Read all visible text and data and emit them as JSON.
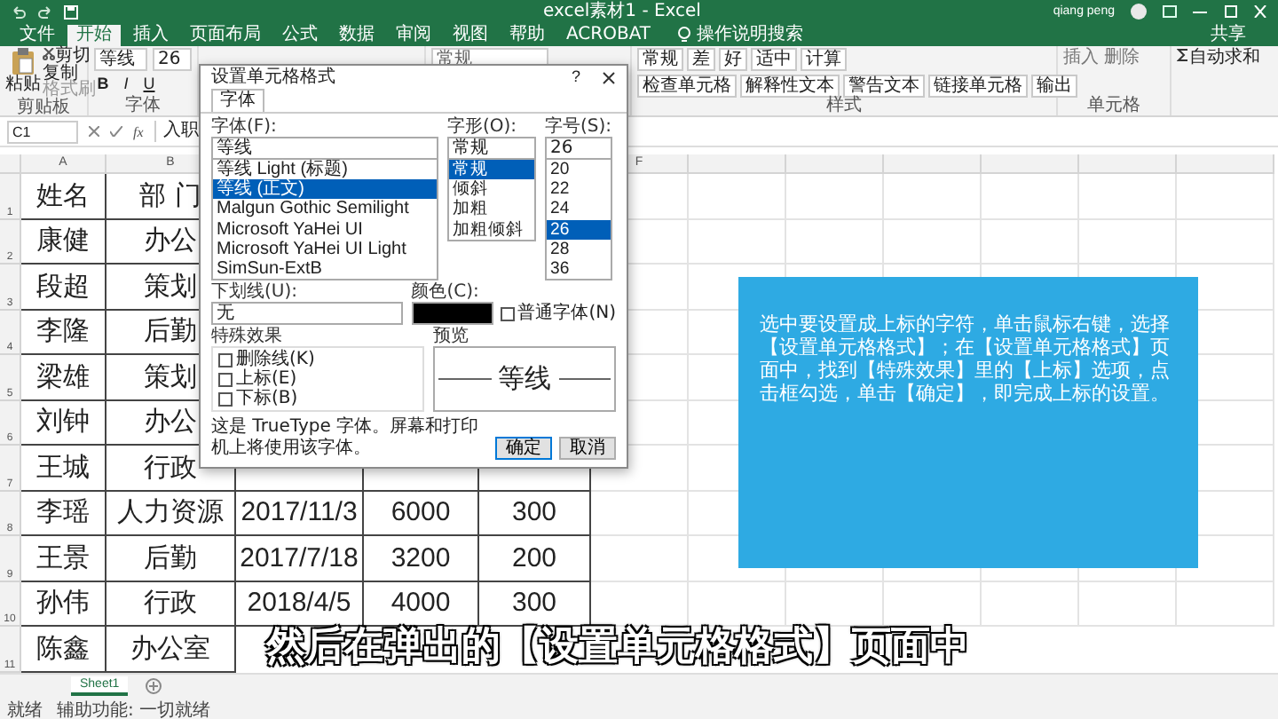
{
  "title_bar": {
    "title": "excel素材1 - Excel",
    "user": "qiang peng"
  },
  "ribbon_tabs": [
    {
      "label": "文件",
      "selected": false
    },
    {
      "label": "开始",
      "selected": true
    },
    {
      "label": "插入",
      "selected": false
    },
    {
      "label": "页面布局",
      "selected": false
    },
    {
      "label": "公式",
      "selected": false
    },
    {
      "label": "数据",
      "selected": false
    },
    {
      "label": "审阅",
      "selected": false
    },
    {
      "label": "视图",
      "selected": false
    },
    {
      "label": "帮助",
      "selected": false
    },
    {
      "label": "ACROBAT",
      "selected": false
    }
  ],
  "tell_me": "操作说明搜索",
  "share": "共享",
  "clipboard": {
    "paste": "粘贴",
    "cut": "剪切",
    "copy": "复制",
    "format_painter": "格式刷",
    "label": "剪贴板"
  },
  "font_group": {
    "font": "等线",
    "size": "26",
    "buttons": [
      "B",
      "I",
      "U"
    ],
    "label": "字体"
  },
  "number_group": {
    "format": "常规"
  },
  "styles_group": {
    "row_1": [
      "常规",
      "差",
      "好",
      "适中",
      "计算"
    ],
    "row_2": [
      "检查单元格",
      "解释性文本",
      "警告文本",
      "链接单元格",
      "输出"
    ],
    "label": "样式"
  },
  "cells_group": {
    "insert": "插入",
    "delete": "删除",
    "label": "单元格"
  },
  "editing_group": {
    "autosum": "自动求和"
  },
  "formula_bar": {
    "name_box": "C1",
    "function_label": "fx",
    "formula": "入职"
  },
  "column_headers_left": [
    "A",
    "B"
  ],
  "column_headers_right": [
    "F"
  ],
  "rows": [
    {
      "num": "1",
      "cells": [
        "姓名",
        "部 门"
      ]
    },
    {
      "num": "2",
      "cells": [
        "康健",
        "办公"
      ]
    },
    {
      "num": "3",
      "cells": [
        "段超",
        "策划"
      ]
    },
    {
      "num": "4",
      "cells": [
        "李隆",
        "后勤"
      ]
    },
    {
      "num": "5",
      "cells": [
        "梁雄",
        "策划"
      ]
    },
    {
      "num": "6",
      "cells": [
        "刘钟",
        "办公"
      ]
    },
    {
      "num": "7",
      "cells": [
        "王城",
        "行政"
      ]
    },
    {
      "num": "8",
      "cells": [
        "李瑶",
        "人力资源",
        "2017/11/3",
        "6000",
        "300"
      ]
    },
    {
      "num": "9",
      "cells": [
        "王景",
        "后勤",
        "2017/7/18",
        "3200",
        "200"
      ]
    },
    {
      "num": "10",
      "cells": [
        "孙伟",
        "行政",
        "2018/4/5",
        "4000",
        "300"
      ]
    },
    {
      "num": "11",
      "cells": [
        "陈鑫",
        "办公室"
      ]
    }
  ],
  "sheet_tabs": [
    {
      "label": "Sheet1",
      "selected": true
    }
  ],
  "status_bar": {
    "ready": "就绪",
    "accessibility": "辅助功能: 一切就绪"
  },
  "dialog": {
    "title": "设置单元格格式",
    "help": "?",
    "tab": "字体",
    "font": {
      "label": "字体(F):",
      "value": "等线",
      "items": [
        {
          "label": "等线 Light (标题)",
          "selected": false
        },
        {
          "label": "等线 (正文)",
          "selected": true
        },
        {
          "label": "Malgun Gothic Semilight",
          "selected": false
        },
        {
          "label": "Microsoft YaHei UI",
          "selected": false
        },
        {
          "label": "Microsoft YaHei UI Light",
          "selected": false
        },
        {
          "label": "SimSun-ExtB",
          "selected": false
        }
      ]
    },
    "style": {
      "label": "字形(O):",
      "value": "常规",
      "items": [
        {
          "label": "常规",
          "selected": true
        },
        {
          "label": "倾斜",
          "selected": false
        },
        {
          "label": "加粗",
          "selected": false
        },
        {
          "label": "加粗倾斜",
          "selected": false
        }
      ]
    },
    "size": {
      "label": "字号(S):",
      "value": "26",
      "items": [
        {
          "label": "20",
          "selected": false
        },
        {
          "label": "22",
          "selected": false
        },
        {
          "label": "24",
          "selected": false
        },
        {
          "label": "26",
          "selected": true
        },
        {
          "label": "28",
          "selected": false
        },
        {
          "label": "36",
          "selected": false
        }
      ]
    },
    "underline": {
      "label": "下划线(U):",
      "value": "无"
    },
    "color": {
      "label": "颜色(C):",
      "color": "#000000"
    },
    "normal_font": {
      "label": "普通字体(N)",
      "checked": false
    },
    "effects": {
      "label": "特殊效果",
      "items": [
        {
          "label": "删除线(K)",
          "checked": false
        },
        {
          "label": "上标(E)",
          "checked": false
        },
        {
          "label": "下标(B)",
          "checked": false
        }
      ]
    },
    "preview": {
      "label": "预览",
      "sample": "等线"
    },
    "note": "这是 TrueType 字体。屏幕和打印机上将使用该字体。",
    "buttons": [
      {
        "label": "确定",
        "default": true
      },
      {
        "label": "取消",
        "default": false
      }
    ]
  },
  "callout": "选中要设置成上标的字符，单击鼠标右键，选择【设置单元格格式】；在【设置单元格格式】页面中，找到【特殊效果】里的【上标】选项，点击框勾选，单击【确定】，即完成上标的设置。",
  "subtitle": "然后在弹出的【设置单元格格式】页面中"
}
